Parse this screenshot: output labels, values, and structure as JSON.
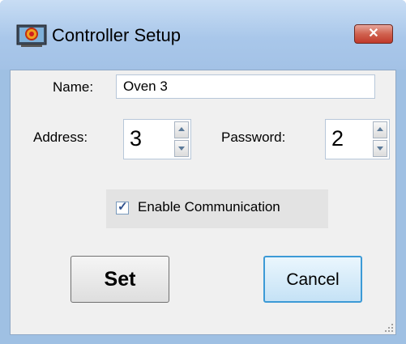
{
  "window": {
    "title": "Controller Setup",
    "close_glyph": "✕"
  },
  "form": {
    "name_label": "Name:",
    "name_value": "Oven 3",
    "address_label": "Address:",
    "address_value": "3",
    "password_label": "Password:",
    "password_value": "2",
    "enable_label": "Enable Communication",
    "enable_checked": true
  },
  "buttons": {
    "set_label": "Set",
    "cancel_label": "Cancel"
  },
  "colors": {
    "titlebar": "#a9c7ea",
    "close": "#c0392b",
    "focus_border": "#3c9ad6"
  },
  "icons": [
    "app-icon",
    "close-icon",
    "spin-up-icon",
    "spin-down-icon",
    "check-icon",
    "resize-grip-icon"
  ]
}
